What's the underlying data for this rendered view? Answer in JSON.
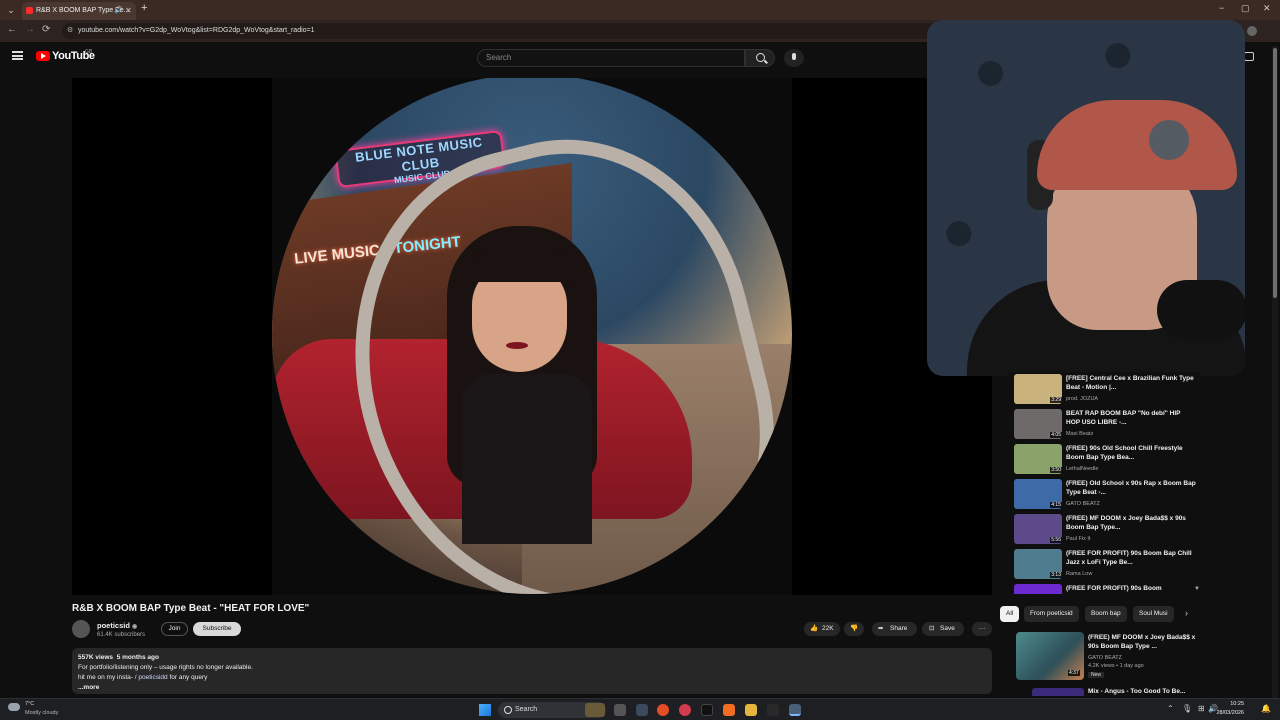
{
  "browser": {
    "tab_title": "R&B X BOOM BAP Type Be...",
    "url": "youtube.com/watch?v=G2dp_WoVtog&list=RDG2dp_WoVtog&start_radio=1",
    "new_tab": "+",
    "back": "←",
    "forward": "→",
    "reload": "⟳",
    "minimize": "−",
    "maximize": "▢",
    "close": "✕"
  },
  "header": {
    "logo_text": "YouTube",
    "country": "GB",
    "search_placeholder": "Search"
  },
  "video": {
    "sign_line1": "BLUE NOTE MUSIC CLUB",
    "sign_line2": "MUSIC CLUB",
    "sign_live": "LIVE MUSIC",
    "sign_tonight": "TONIGHT",
    "title": "R&B X BOOM BAP Type Beat - \"HEAT FOR LOVE\"",
    "channel": "poeticsid",
    "verified": "◉",
    "subscribers": "61.4K subscribers",
    "join": "Join",
    "subscribe": "Subscribe",
    "likes": "22K",
    "share": "Share",
    "save": "Save",
    "more": "···",
    "views": "557K views",
    "age": "5 months ago",
    "desc_line1": "For portfolio/listening only – usage rights no longer available.",
    "desc_line2a": "hit me on my insta-",
    "desc_line2b": "/ poeticsidd",
    "desc_line2c": "for any query",
    "desc_more": "...more"
  },
  "playlist": [
    {
      "title": "[FREE] Central Cee x Brazilian Funk Type Beat - Motion |...",
      "channel": "prod. JOZUA",
      "duration": "3:29",
      "color": "#c9b27c"
    },
    {
      "title": "BEAT RAP BOOM BAP \"No debí\" HIP HOP USO LIBRE -...",
      "channel": "Maxi Beatz",
      "duration": "4:05",
      "color": "#6f6a6a"
    },
    {
      "title": "(FREE) 90s Old School Chill Freestyle Boom Bap Type Bea...",
      "channel": "LethalNeedle",
      "duration": "3:50",
      "color": "#8aa36b"
    },
    {
      "title": "(FREE) Old School x 90s Rap x Boom Bap Type Beat -...",
      "channel": "GATO BEATZ",
      "duration": "4:15",
      "color": "#3f6aa8"
    },
    {
      "title": "(FREE) MF DOOM x Joey Bada$$ x 90s Boom Bap Type...",
      "channel": "Paul Fix It",
      "duration": "5:56",
      "color": "#5c4a8a"
    },
    {
      "title": "(FREE FOR PROFIT) 90s Boom Bap Chill Jazz x LoFi Type Be...",
      "channel": "Rama Low",
      "duration": "3:13",
      "color": "#4f7d8f"
    },
    {
      "title": "(FREE FOR PROFIT) 90s Boom",
      "channel": "",
      "duration": "",
      "color": "#6b2bd0"
    }
  ],
  "chips": [
    "All",
    "From poeticsid",
    "Boom bap",
    "Soul Musi"
  ],
  "recommended": {
    "title": "(FREE) MF DOOM x Joey Bada$$ x 90s Boom Bap Type ...",
    "channel": "GATO BEATZ",
    "meta": "4.2K views • 1 day ago",
    "badge": "New",
    "duration": "4:37",
    "next_title": "Mix - Angus - Too Good To Be..."
  },
  "taskbar": {
    "temp": "7°C",
    "weather": "Mostly cloudy",
    "search": "Search",
    "time": "10:25",
    "date": "28/03/2026"
  }
}
